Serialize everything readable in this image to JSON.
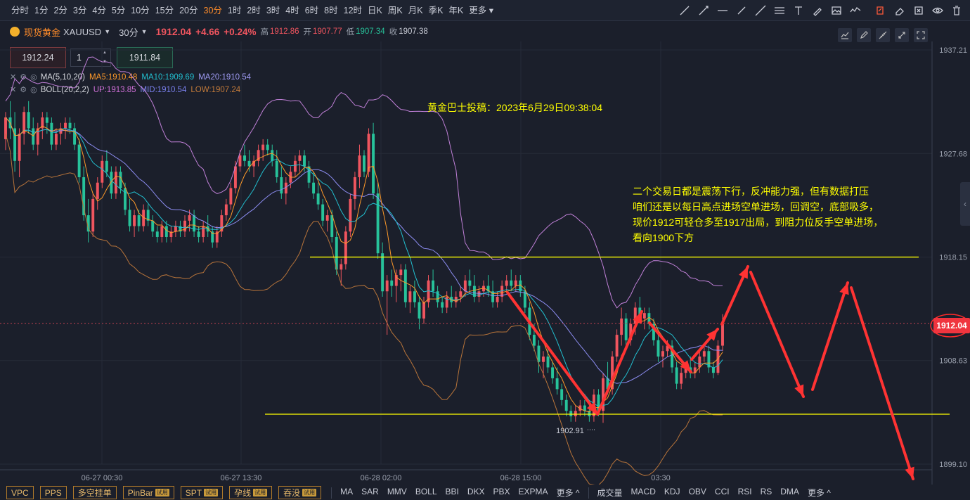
{
  "periods": [
    "分时",
    "1分",
    "2分",
    "3分",
    "4分",
    "5分",
    "10分",
    "15分",
    "20分",
    "30分",
    "1时",
    "2时",
    "3时",
    "4时",
    "6时",
    "8时",
    "12时",
    "日K",
    "周K",
    "月K",
    "季K",
    "年K",
    "更多"
  ],
  "active_period": "30分",
  "drawing_tools": [
    "trend-line-icon",
    "ray-icon",
    "horizontal-line-icon",
    "segment-icon",
    "extended-line-icon",
    "fibonacci-icon",
    "text-icon",
    "highlight-icon",
    "image-icon",
    "wave-icon",
    "edit-icon",
    "eraser-icon",
    "delete-icon",
    "visibility-icon",
    "trash-icon"
  ],
  "symbol": {
    "name": "现货黄金",
    "code": "XAUUSD",
    "interval": "30分",
    "last": "1912.04",
    "change": "+4.66",
    "change_pct": "+0.24%",
    "high_label": "高",
    "high": "1912.86",
    "open_label": "开",
    "open": "1907.77",
    "low_label": "低",
    "low": "1907.34",
    "close_label": "收",
    "close": "1907.38"
  },
  "order": {
    "sell_price": "1912.24",
    "quantity": "1",
    "buy_price": "1911.84"
  },
  "indicators": {
    "ma": {
      "name": "MA(5,10,20)",
      "ma5": "MA5:1910.48",
      "ma10": "MA10:1909.69",
      "ma20": "MA20:1910.54"
    },
    "boll": {
      "name": "BOLL(20,2,2)",
      "up": "UP:1913.85",
      "mid": "MID:1910.54",
      "low": "LOW:1907.24"
    }
  },
  "annotations": {
    "title": "黄金巴士投稿：2023年6月29日09:38:04",
    "analysis": [
      "二个交易日都是震荡下行，反冲能力强，但有数据打压",
      "咱们还是以每日高点进场空单进场，回调空，底部吸多，",
      "现价1912可轻仓多至1917出局，到阻力位反手空单进场，",
      "看向1900下方"
    ],
    "low_marker": "1902.91"
  },
  "bottom_tabs": [
    {
      "label": "VPC",
      "trial": false
    },
    {
      "label": "PPS",
      "trial": false
    },
    {
      "label": "多空挂单",
      "trial": false
    },
    {
      "label": "PinBar",
      "trial": true
    },
    {
      "label": "SPT",
      "trial": true
    },
    {
      "label": "孕线",
      "trial": true
    },
    {
      "label": "吞没",
      "trial": true
    }
  ],
  "trial_label": "试用",
  "main_indicators": [
    "MA",
    "SAR",
    "MMV",
    "BOLL",
    "BBI",
    "DKX",
    "PBX",
    "EXPMA",
    "更多 ^"
  ],
  "sub_indicators": [
    "成交量",
    "MACD",
    "KDJ",
    "OBV",
    "CCI",
    "RSI",
    "RS",
    "DMA",
    "更多 ^"
  ],
  "colors": {
    "up": "#f0555f",
    "down": "#27c29a",
    "ma5": "#ff9a2a",
    "ma10": "#22c0d0",
    "ma20": "#8c8cf0",
    "boll_up": "#c080d8",
    "boll_low": "#b8743a",
    "accent": "#ff8c2a",
    "annotation": "#ffff00",
    "arrow": "#ff3333"
  },
  "chart_data": {
    "type": "candlestick",
    "time_ticks": [
      "06-27 00:30",
      "06-27 13:30",
      "06-28 02:00",
      "06-28 15:00",
      "03:30"
    ],
    "price_ticks": [
      "1937.21",
      "1927.68",
      "1918.15",
      "1908.63",
      "1899.10"
    ],
    "ylim": [
      1899.1,
      1937.21
    ],
    "current_price": "1912.04",
    "candles": [
      [
        1929.0,
        1931.5,
        1928.0,
        1931.0
      ],
      [
        1931.0,
        1932.5,
        1929.0,
        1930.0
      ],
      [
        1930.0,
        1931.5,
        1926.0,
        1927.0
      ],
      [
        1927.0,
        1930.0,
        1925.5,
        1929.5
      ],
      [
        1929.5,
        1932.0,
        1928.5,
        1931.5
      ],
      [
        1931.5,
        1932.5,
        1929.5,
        1930.0
      ],
      [
        1930.0,
        1931.0,
        1928.0,
        1928.5
      ],
      [
        1928.5,
        1930.5,
        1927.5,
        1930.0
      ],
      [
        1930.0,
        1931.5,
        1929.0,
        1931.0
      ],
      [
        1931.0,
        1931.5,
        1929.5,
        1930.5
      ],
      [
        1930.5,
        1931.0,
        1928.0,
        1928.5
      ],
      [
        1928.5,
        1930.0,
        1928.0,
        1929.5
      ],
      [
        1929.5,
        1930.5,
        1928.5,
        1930.0
      ],
      [
        1930.0,
        1931.0,
        1929.0,
        1930.5
      ],
      [
        1930.5,
        1931.0,
        1929.5,
        1930.0
      ],
      [
        1930.0,
        1930.5,
        1928.0,
        1928.5
      ],
      [
        1928.5,
        1929.0,
        1925.0,
        1925.5
      ],
      [
        1925.5,
        1926.5,
        1921.5,
        1922.0
      ],
      [
        1922.0,
        1923.5,
        1919.5,
        1920.5
      ],
      [
        1920.5,
        1924.0,
        1920.0,
        1923.5
      ],
      [
        1923.5,
        1925.5,
        1922.5,
        1925.0
      ],
      [
        1925.0,
        1927.5,
        1924.5,
        1927.0
      ],
      [
        1927.0,
        1928.0,
        1925.5,
        1926.0
      ],
      [
        1926.0,
        1926.5,
        1923.5,
        1924.0
      ],
      [
        1924.0,
        1926.5,
        1923.5,
        1926.0
      ],
      [
        1926.0,
        1926.5,
        1924.0,
        1924.5
      ],
      [
        1924.5,
        1925.0,
        1922.0,
        1922.5
      ],
      [
        1922.5,
        1923.5,
        1920.5,
        1921.0
      ],
      [
        1921.0,
        1922.5,
        1920.0,
        1922.0
      ],
      [
        1922.0,
        1922.5,
        1920.5,
        1921.0
      ],
      [
        1921.0,
        1923.0,
        1920.5,
        1922.5
      ],
      [
        1922.5,
        1923.0,
        1921.0,
        1921.5
      ],
      [
        1921.5,
        1922.0,
        1920.0,
        1920.5
      ],
      [
        1920.5,
        1921.0,
        1919.5,
        1920.0
      ],
      [
        1920.0,
        1921.5,
        1919.5,
        1921.0
      ],
      [
        1921.0,
        1921.5,
        1919.5,
        1920.0
      ],
      [
        1920.0,
        1921.0,
        1919.5,
        1920.5
      ],
      [
        1920.5,
        1921.5,
        1920.0,
        1921.0
      ],
      [
        1921.0,
        1921.5,
        1920.0,
        1920.5
      ],
      [
        1920.5,
        1922.0,
        1920.0,
        1921.5
      ],
      [
        1921.5,
        1922.5,
        1920.5,
        1922.0
      ],
      [
        1922.0,
        1922.5,
        1920.0,
        1920.5
      ],
      [
        1920.5,
        1921.0,
        1919.5,
        1920.0
      ],
      [
        1920.0,
        1921.5,
        1919.5,
        1921.0
      ],
      [
        1921.0,
        1922.0,
        1920.0,
        1920.5
      ],
      [
        1920.5,
        1921.0,
        1919.0,
        1919.5
      ],
      [
        1919.5,
        1921.0,
        1919.0,
        1920.5
      ],
      [
        1920.5,
        1922.5,
        1920.0,
        1922.0
      ],
      [
        1922.0,
        1923.5,
        1921.5,
        1923.0
      ],
      [
        1923.0,
        1925.0,
        1922.5,
        1924.5
      ],
      [
        1924.5,
        1927.0,
        1924.0,
        1926.5
      ],
      [
        1926.5,
        1928.0,
        1926.0,
        1927.5
      ],
      [
        1927.5,
        1928.5,
        1926.5,
        1927.0
      ],
      [
        1927.0,
        1928.0,
        1926.0,
        1926.5
      ],
      [
        1926.5,
        1927.5,
        1925.5,
        1927.0
      ],
      [
        1927.0,
        1928.5,
        1926.5,
        1928.0
      ],
      [
        1928.0,
        1929.0,
        1927.0,
        1928.5
      ],
      [
        1928.5,
        1929.0,
        1927.5,
        1928.0
      ],
      [
        1928.0,
        1928.5,
        1926.5,
        1927.0
      ],
      [
        1927.0,
        1928.0,
        1925.0,
        1925.5
      ],
      [
        1925.5,
        1926.5,
        1923.5,
        1924.0
      ],
      [
        1924.0,
        1925.5,
        1923.0,
        1925.0
      ],
      [
        1925.0,
        1926.5,
        1924.5,
        1926.0
      ],
      [
        1926.0,
        1927.5,
        1925.5,
        1927.0
      ],
      [
        1927.0,
        1928.0,
        1926.0,
        1927.5
      ],
      [
        1927.5,
        1928.0,
        1926.0,
        1926.5
      ],
      [
        1926.5,
        1927.0,
        1924.5,
        1925.0
      ],
      [
        1925.0,
        1926.0,
        1923.5,
        1924.0
      ],
      [
        1924.0,
        1925.0,
        1922.5,
        1923.0
      ],
      [
        1923.0,
        1923.5,
        1921.0,
        1921.5
      ],
      [
        1921.5,
        1922.5,
        1920.5,
        1922.0
      ],
      [
        1922.0,
        1922.5,
        1919.5,
        1920.0
      ],
      [
        1920.0,
        1920.5,
        1916.5,
        1917.0
      ],
      [
        1917.0,
        1918.0,
        1915.5,
        1917.5
      ],
      [
        1917.5,
        1921.0,
        1917.0,
        1920.5
      ],
      [
        1920.5,
        1924.0,
        1920.0,
        1923.5
      ],
      [
        1923.5,
        1926.0,
        1922.5,
        1925.5
      ],
      [
        1925.5,
        1928.5,
        1924.5,
        1927.5
      ],
      [
        1927.5,
        1928.0,
        1925.5,
        1926.0
      ],
      [
        1926.0,
        1930.0,
        1925.5,
        1929.5
      ],
      [
        1929.5,
        1930.5,
        1923.5,
        1924.0
      ],
      [
        1924.0,
        1925.0,
        1918.0,
        1918.5
      ],
      [
        1918.5,
        1919.5,
        1914.5,
        1915.0
      ],
      [
        1915.0,
        1916.5,
        1911.0,
        1916.0
      ],
      [
        1916.0,
        1917.0,
        1914.5,
        1915.5
      ],
      [
        1915.5,
        1917.0,
        1914.0,
        1916.5
      ],
      [
        1916.5,
        1917.5,
        1915.0,
        1917.0
      ],
      [
        1917.0,
        1917.5,
        1913.5,
        1914.0
      ],
      [
        1914.0,
        1915.5,
        1913.0,
        1915.0
      ],
      [
        1915.0,
        1916.0,
        1913.5,
        1914.0
      ],
      [
        1914.0,
        1914.5,
        1911.5,
        1912.5
      ],
      [
        1912.5,
        1914.5,
        1912.0,
        1914.0
      ],
      [
        1914.0,
        1916.5,
        1913.5,
        1916.0
      ],
      [
        1916.0,
        1917.0,
        1914.5,
        1915.0
      ],
      [
        1915.0,
        1915.5,
        1913.5,
        1914.0
      ],
      [
        1914.0,
        1914.5,
        1913.0,
        1913.5
      ],
      [
        1913.5,
        1915.0,
        1913.0,
        1914.5
      ],
      [
        1914.5,
        1915.5,
        1913.5,
        1914.0
      ],
      [
        1914.0,
        1915.0,
        1913.5,
        1914.5
      ],
      [
        1914.5,
        1915.5,
        1914.0,
        1915.0
      ],
      [
        1915.0,
        1916.5,
        1914.5,
        1916.0
      ],
      [
        1916.0,
        1917.0,
        1915.0,
        1915.5
      ],
      [
        1915.5,
        1916.5,
        1914.0,
        1914.5
      ],
      [
        1914.5,
        1915.5,
        1914.0,
        1915.0
      ],
      [
        1915.0,
        1916.0,
        1914.5,
        1915.5
      ],
      [
        1915.5,
        1916.5,
        1914.5,
        1915.0
      ],
      [
        1915.0,
        1916.0,
        1913.5,
        1914.0
      ],
      [
        1914.0,
        1915.0,
        1913.5,
        1914.5
      ],
      [
        1914.5,
        1916.0,
        1914.0,
        1915.5
      ],
      [
        1915.5,
        1916.5,
        1915.0,
        1916.0
      ],
      [
        1916.0,
        1917.0,
        1915.0,
        1915.5
      ],
      [
        1915.5,
        1916.5,
        1915.0,
        1916.0
      ],
      [
        1916.0,
        1916.5,
        1914.5,
        1915.0
      ],
      [
        1915.0,
        1915.5,
        1913.0,
        1913.5
      ],
      [
        1913.5,
        1914.0,
        1910.5,
        1911.0
      ],
      [
        1911.0,
        1912.0,
        1909.5,
        1910.0
      ],
      [
        1910.0,
        1910.5,
        1907.5,
        1908.5
      ],
      [
        1908.5,
        1909.5,
        1907.0,
        1909.0
      ],
      [
        1909.0,
        1910.0,
        1907.5,
        1908.0
      ],
      [
        1908.0,
        1908.5,
        1906.5,
        1907.0
      ],
      [
        1907.0,
        1908.0,
        1905.5,
        1906.0
      ],
      [
        1906.0,
        1906.5,
        1904.5,
        1905.0
      ],
      [
        1905.0,
        1905.5,
        1903.5,
        1904.0
      ],
      [
        1904.0,
        1904.5,
        1903.0,
        1903.5
      ],
      [
        1903.5,
        1904.5,
        1903.0,
        1904.0
      ],
      [
        1904.0,
        1905.0,
        1903.5,
        1904.5
      ],
      [
        1904.5,
        1905.0,
        1903.5,
        1904.0
      ],
      [
        1904.0,
        1904.5,
        1903.0,
        1903.5
      ],
      [
        1903.5,
        1906.0,
        1903.0,
        1905.5
      ],
      [
        1905.5,
        1906.0,
        1903.5,
        1904.0
      ],
      [
        1904.0,
        1907.5,
        1902.9,
        1907.0
      ],
      [
        1907.0,
        1908.5,
        1905.5,
        1906.0
      ],
      [
        1906.0,
        1909.5,
        1905.5,
        1909.0
      ],
      [
        1909.0,
        1911.5,
        1908.5,
        1911.0
      ],
      [
        1911.0,
        1913.5,
        1910.0,
        1912.5
      ],
      [
        1912.5,
        1913.0,
        1910.0,
        1910.5
      ],
      [
        1910.5,
        1912.5,
        1910.0,
        1912.0
      ],
      [
        1912.0,
        1914.0,
        1911.0,
        1913.5
      ],
      [
        1913.5,
        1914.5,
        1912.0,
        1912.5
      ],
      [
        1912.5,
        1913.5,
        1911.5,
        1913.0
      ],
      [
        1913.0,
        1913.5,
        1911.5,
        1912.0
      ],
      [
        1912.0,
        1912.5,
        1910.0,
        1910.5
      ],
      [
        1910.5,
        1911.0,
        1908.5,
        1909.0
      ],
      [
        1909.0,
        1910.0,
        1908.0,
        1909.5
      ],
      [
        1909.5,
        1910.5,
        1909.0,
        1910.0
      ],
      [
        1910.0,
        1910.5,
        1907.5,
        1908.0
      ],
      [
        1908.0,
        1908.5,
        1906.0,
        1906.5
      ],
      [
        1906.5,
        1908.0,
        1906.0,
        1907.5
      ],
      [
        1907.5,
        1908.5,
        1907.0,
        1908.0
      ],
      [
        1908.0,
        1909.0,
        1907.0,
        1907.5
      ],
      [
        1907.5,
        1908.5,
        1907.0,
        1908.0
      ],
      [
        1908.0,
        1909.5,
        1907.5,
        1909.0
      ],
      [
        1909.0,
        1910.0,
        1908.5,
        1909.5
      ],
      [
        1909.5,
        1910.0,
        1907.5,
        1908.0
      ],
      [
        1908.0,
        1908.5,
        1907.0,
        1907.5
      ],
      [
        1907.5,
        1910.5,
        1907.3,
        1910.0
      ],
      [
        1910.0,
        1912.9,
        1909.5,
        1912.0
      ]
    ],
    "horizontal_levels": [
      1918.15,
      1902.91
    ]
  }
}
